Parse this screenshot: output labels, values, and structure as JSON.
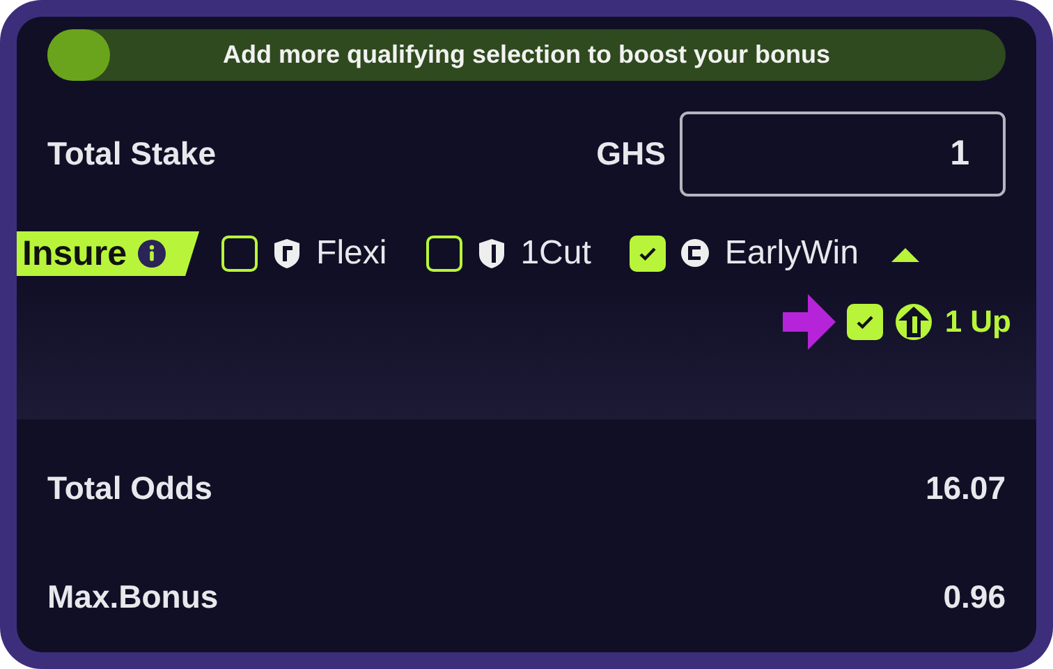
{
  "bonus_bar": {
    "level": 0.065,
    "message": "Add more qualifying selection to boost your bonus"
  },
  "stake": {
    "label": "Total Stake",
    "currency": "GHS",
    "value": "1"
  },
  "insurance": {
    "label": "Insure",
    "expanded": true,
    "options": [
      {
        "label": "Flexi",
        "checked": false,
        "kind": "flexi"
      },
      {
        "label": "1Cut",
        "checked": false,
        "kind": "cut"
      },
      {
        "label": "EarlyWin",
        "checked": true,
        "kind": "early"
      }
    ],
    "extra": {
      "label": "1 Up",
      "checked": true
    }
  },
  "summary": [
    {
      "label": "Total Odds",
      "value": "16.07"
    },
    {
      "label": "Max.Bonus",
      "value": "0.96"
    }
  ]
}
